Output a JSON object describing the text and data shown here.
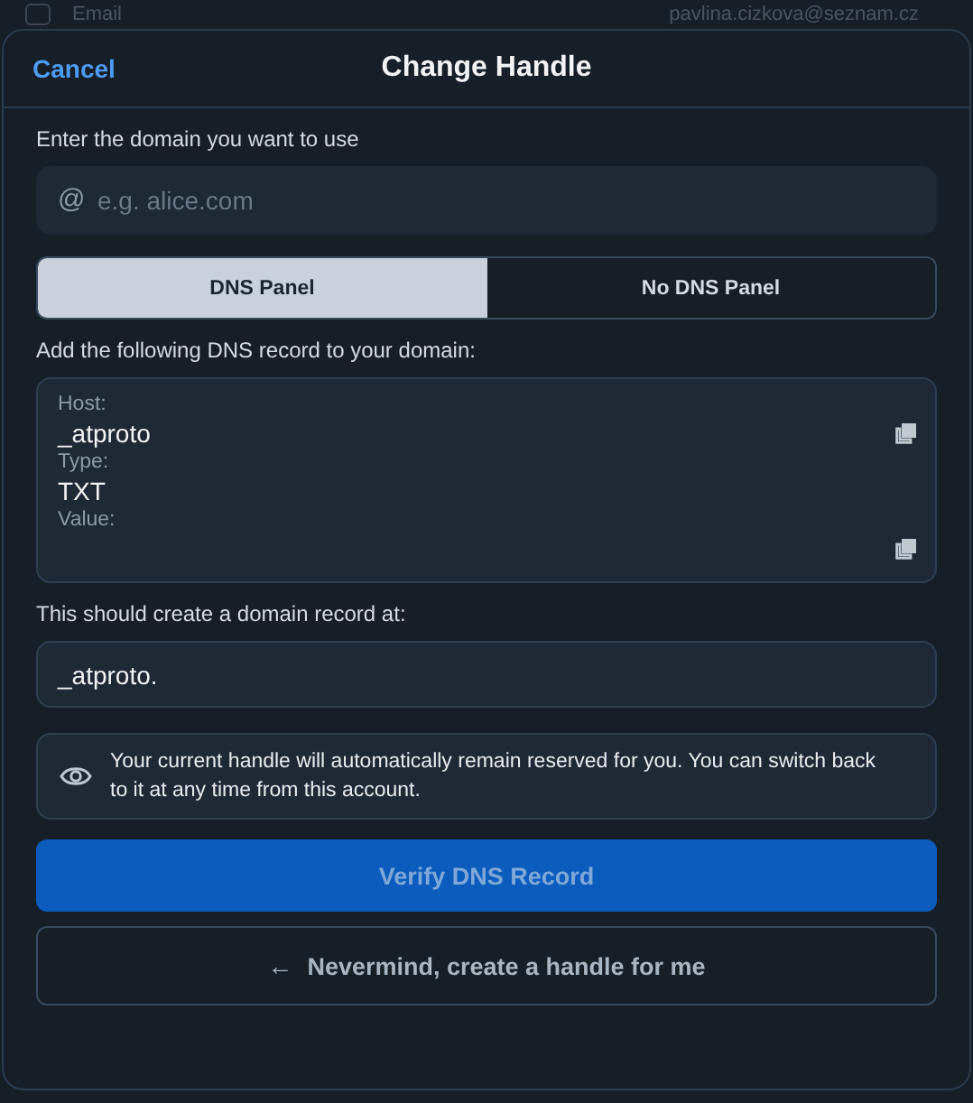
{
  "background_row": {
    "checked": false,
    "label": "Email",
    "value": "pavlina.cizkova@seznam.cz"
  },
  "dialog": {
    "cancel": "Cancel",
    "title": "Change Handle"
  },
  "domain_field": {
    "label": "Enter the domain you want to use",
    "prefix": "@",
    "placeholder": "e.g. alice.com"
  },
  "tabs": [
    {
      "label": "DNS Panel",
      "selected": true
    },
    {
      "label": "No DNS Panel",
      "selected": false
    }
  ],
  "record_intro": "Add the following DNS record to your domain:",
  "record": [
    {
      "label": "Host:",
      "value": "_atproto",
      "copyable": true
    },
    {
      "label": "Type:",
      "value": "TXT",
      "copyable": false
    },
    {
      "label": "Value:",
      "copyable": true
    }
  ],
  "result_label": "This should create a domain record at:",
  "result_value": "_atproto.",
  "notice": "Your current handle will automatically remain reserved for you. You can switch back to it at any time from this account.",
  "verify_button": {
    "label": "Verify DNS Record",
    "disabled": true
  },
  "back_button": {
    "arrow": "←",
    "label": "Nevermind, create a handle for me"
  }
}
